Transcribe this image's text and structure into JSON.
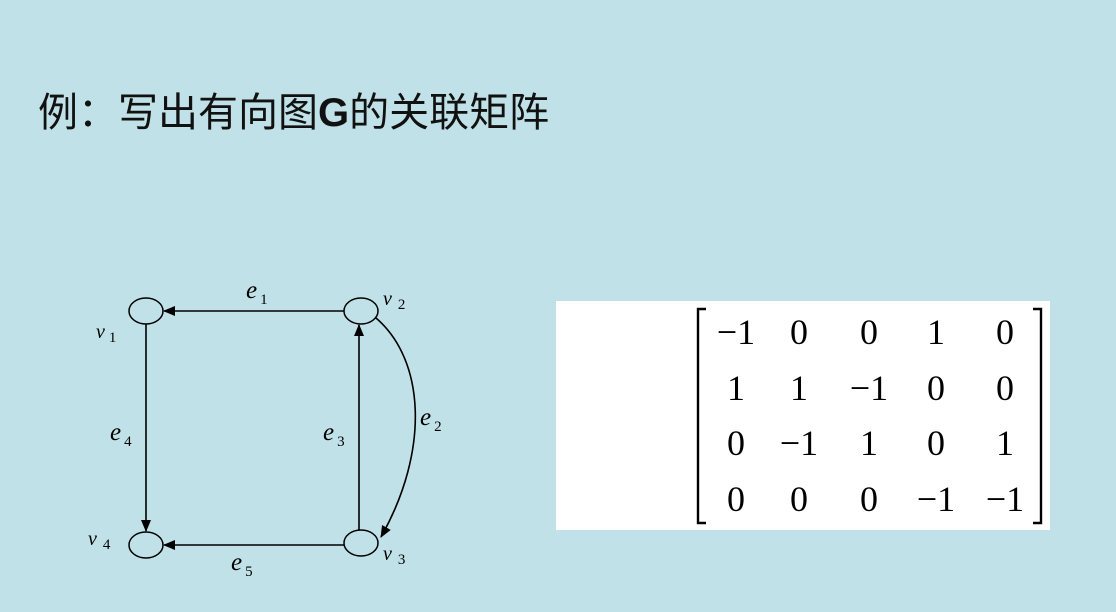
{
  "title": {
    "prefix": "例：写出有向图",
    "graph_name": "G",
    "suffix": "的关联矩阵"
  },
  "graph": {
    "vertices": [
      {
        "id": "v1",
        "symbol": "v",
        "sub": "1"
      },
      {
        "id": "v2",
        "symbol": "v",
        "sub": "2"
      },
      {
        "id": "v3",
        "symbol": "v",
        "sub": "3"
      },
      {
        "id": "v4",
        "symbol": "v",
        "sub": "4"
      }
    ],
    "edges": [
      {
        "id": "e1",
        "symbol": "e",
        "sub": "1",
        "from": "v2",
        "to": "v1"
      },
      {
        "id": "e2",
        "symbol": "e",
        "sub": "2",
        "from": "v2",
        "to": "v3"
      },
      {
        "id": "e3",
        "symbol": "e",
        "sub": "3",
        "from": "v3",
        "to": "v2"
      },
      {
        "id": "e4",
        "symbol": "e",
        "sub": "4",
        "from": "v1",
        "to": "v4"
      },
      {
        "id": "e5",
        "symbol": "e",
        "sub": "5",
        "from": "v3",
        "to": "v4"
      }
    ]
  },
  "matrix": {
    "rows": [
      [
        "−1",
        "0",
        "0",
        "1",
        "0"
      ],
      [
        "1",
        "1",
        "−1",
        "0",
        "0"
      ],
      [
        "0",
        "−1",
        "1",
        "0",
        "1"
      ],
      [
        "0",
        "0",
        "0",
        "−1",
        "−1"
      ]
    ]
  }
}
